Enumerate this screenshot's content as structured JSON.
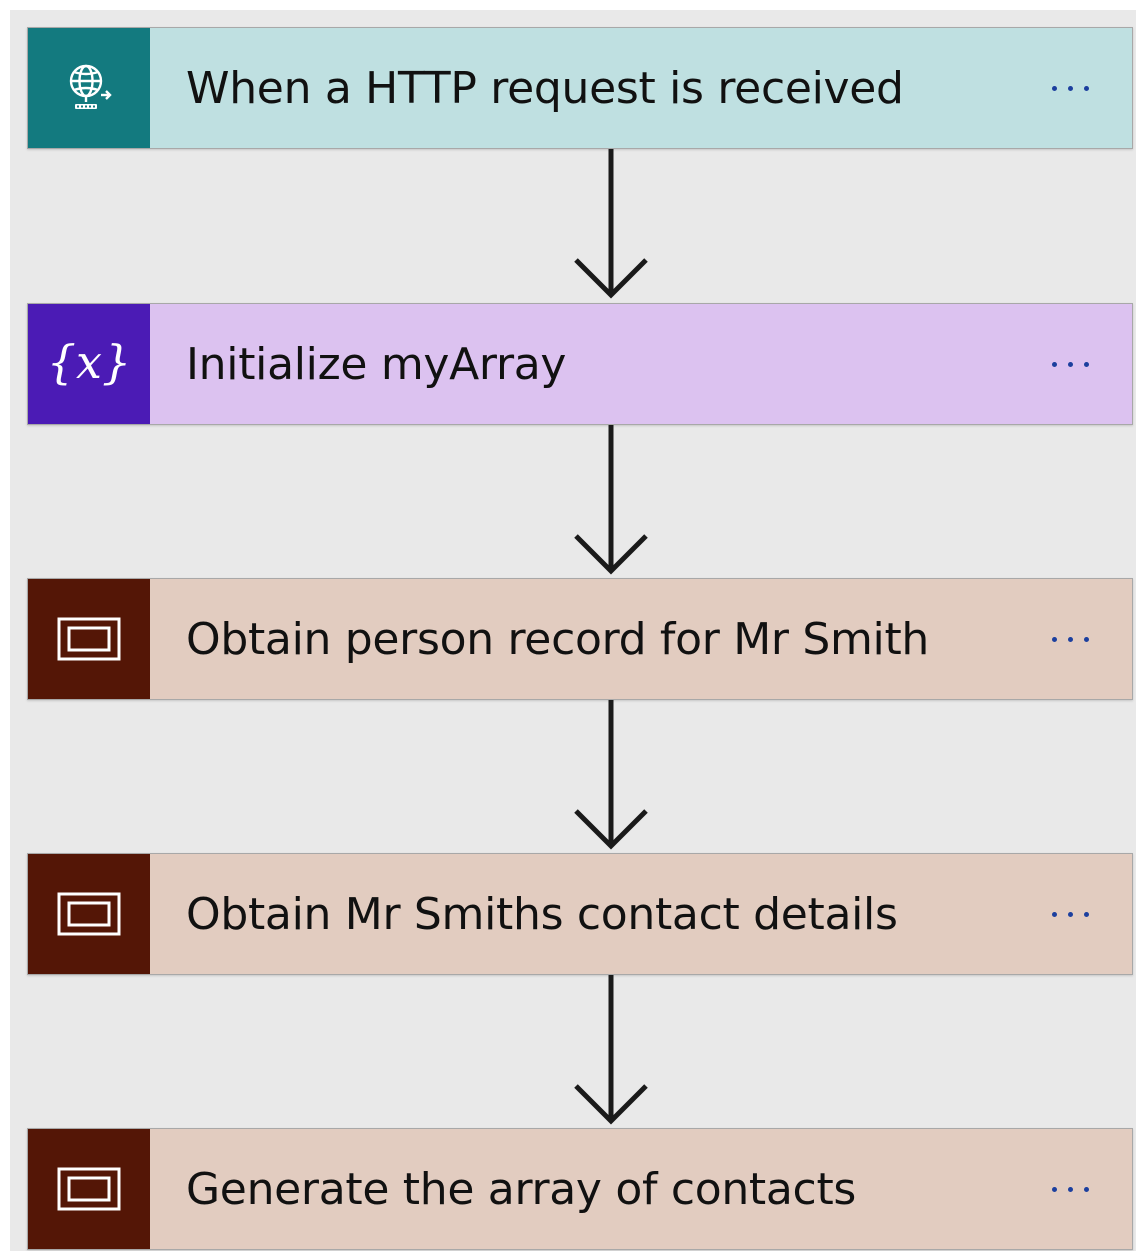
{
  "colors": {
    "canvas": "#e9e9e9",
    "arrow": "#1a1a1a",
    "dots": "#1c3f9e"
  },
  "steps": [
    {
      "title": "When a HTTP request is received",
      "icon": "globe-request-icon",
      "icon_bg": "#137a7f",
      "card_bg": "#bfe0e1"
    },
    {
      "title": "Initialize myArray",
      "icon": "variable-braces-icon",
      "icon_bg": "#4b1bb5",
      "card_bg": "#dcc2f0"
    },
    {
      "title": "Obtain person record for Mr Smith",
      "icon": "compose-icon",
      "icon_bg": "#541606",
      "card_bg": "#e2ccc0"
    },
    {
      "title": "Obtain Mr Smiths contact details",
      "icon": "compose-icon",
      "icon_bg": "#541606",
      "card_bg": "#e2ccc0"
    },
    {
      "title": "Generate the array of contacts",
      "icon": "compose-icon",
      "icon_bg": "#541606",
      "card_bg": "#e2ccc0"
    }
  ]
}
